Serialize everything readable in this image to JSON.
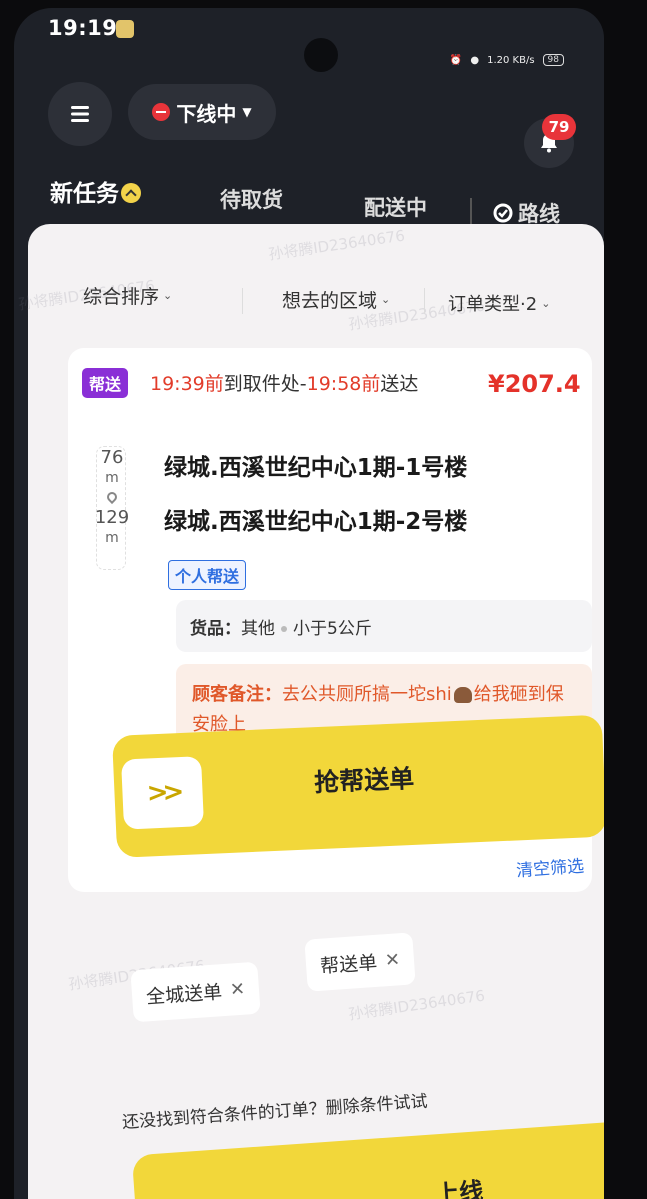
{
  "status_bar": {
    "time": "19:19",
    "net_speed": "1.20 KB/s",
    "battery": "98"
  },
  "header": {
    "status_label": "下线中",
    "notification_count": "79"
  },
  "tabs": [
    {
      "label": "新任务"
    },
    {
      "label": "待取货"
    },
    {
      "label": "配送中"
    },
    {
      "label": "路线"
    }
  ],
  "filters": [
    {
      "label": "综合排序"
    },
    {
      "label": "想去的区域"
    },
    {
      "label": "订单类型·2"
    }
  ],
  "order": {
    "type_tag": "帮送",
    "pickup_time": "19:39前",
    "pickup_text": "到取件处-",
    "delivery_time": "19:58前",
    "delivery_text": "送达",
    "price": "¥207.4",
    "pickup_distance": "76",
    "pickup_unit": "m",
    "delivery_distance": "129",
    "delivery_unit": "m",
    "pickup_address": "绿城.西溪世纪中心1期-1号楼",
    "delivery_address": "绿城.西溪世纪中心1期-2号楼",
    "personal_tag": "个人帮送",
    "goods_label": "货品：",
    "goods_type": "其他",
    "goods_weight": "小于5公斤",
    "note_label": "顾客备注：",
    "note_text_1": "去公共厕所搞一坨shi",
    "note_text_2": "给我砸到保安脸上",
    "grab_label": "抢帮送单"
  },
  "empty_state": {
    "hint": "还没找到符合条件的订单？删除条件试试",
    "clear_label": "清空筛选",
    "chips": [
      {
        "label": "全城送单"
      },
      {
        "label": "帮送单"
      }
    ]
  },
  "bottom_button": {
    "label": "上线"
  },
  "watermark_text": "孙将腾ID23640676",
  "colors": {
    "accent_yellow": "#f2d73a",
    "price_red": "#e4322a",
    "tag_purple": "#8a2fd6",
    "link_blue": "#2f6fe0"
  }
}
